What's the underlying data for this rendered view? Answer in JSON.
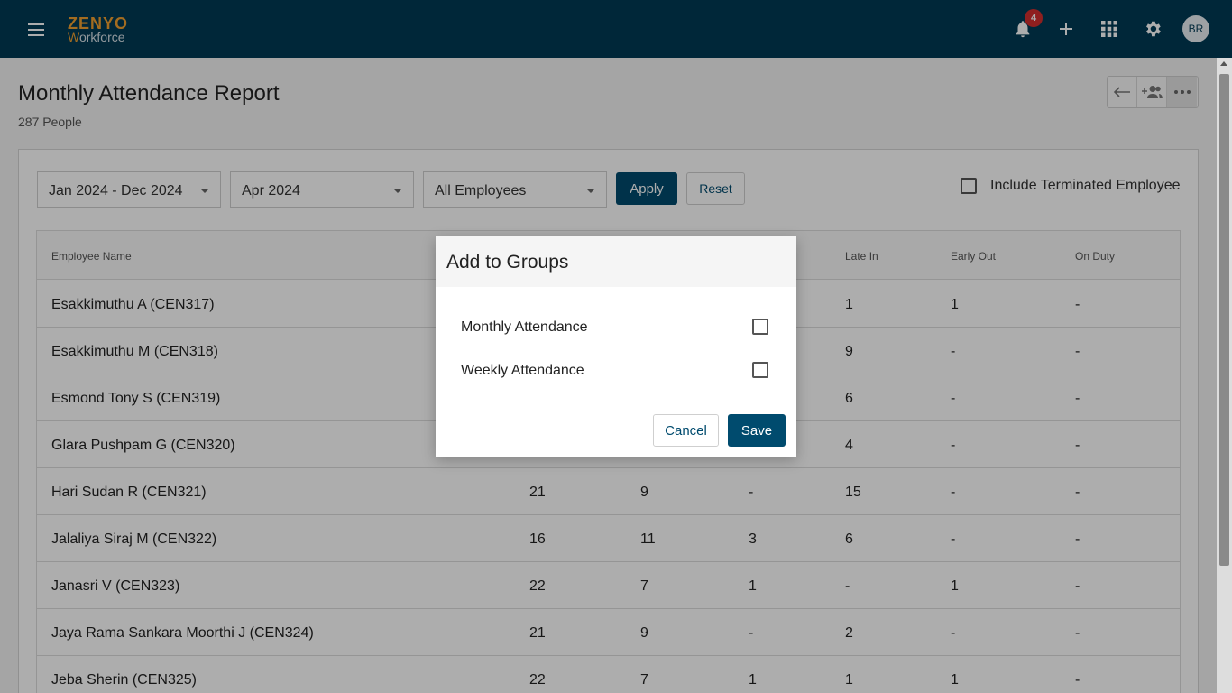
{
  "app": {
    "logo_top": "ZENYO",
    "logo_w": "W",
    "logo_rest": "orkforce",
    "notification_count": "4",
    "avatar_initials": "BR"
  },
  "page": {
    "title": "Monthly Attendance Report",
    "subtitle": "287 People"
  },
  "filters": {
    "period": "Jan 2024 - Dec 2024",
    "month": "Apr 2024",
    "employees": "All Employees",
    "apply_label": "Apply",
    "reset_label": "Reset",
    "include_terminated_label": "Include Terminated Employee"
  },
  "table": {
    "headers": {
      "name": "Employee Name",
      "late_in": "Late In",
      "early_out": "Early Out",
      "on_duty": "On Duty"
    },
    "rows": [
      {
        "name": "Esakkimuthu A (CEN317)",
        "c1": "",
        "c2": "",
        "c3": "",
        "late_in": "1",
        "early_out": "1",
        "on_duty": "-"
      },
      {
        "name": "Esakkimuthu M (CEN318)",
        "c1": "",
        "c2": "",
        "c3": "",
        "late_in": "9",
        "early_out": "-",
        "on_duty": "-"
      },
      {
        "name": "Esmond Tony S (CEN319)",
        "c1": "",
        "c2": "",
        "c3": "",
        "late_in": "6",
        "early_out": "-",
        "on_duty": "-"
      },
      {
        "name": "Glara Pushpam G (CEN320)",
        "c1": "",
        "c2": "",
        "c3": "",
        "late_in": "4",
        "early_out": "-",
        "on_duty": "-"
      },
      {
        "name": "Hari Sudan R (CEN321)",
        "c1": "21",
        "c2": "9",
        "c3": "-",
        "late_in": "15",
        "early_out": "-",
        "on_duty": "-"
      },
      {
        "name": "Jalaliya Siraj M (CEN322)",
        "c1": "16",
        "c2": "11",
        "c3": "3",
        "late_in": "6",
        "early_out": "-",
        "on_duty": "-"
      },
      {
        "name": "Janasri V (CEN323)",
        "c1": "22",
        "c2": "7",
        "c3": "1",
        "late_in": "-",
        "early_out": "1",
        "on_duty": "-"
      },
      {
        "name": "Jaya Rama Sankara Moorthi J (CEN324)",
        "c1": "21",
        "c2": "9",
        "c3": "-",
        "late_in": "2",
        "early_out": "-",
        "on_duty": "-"
      },
      {
        "name": "Jeba Sherin (CEN325)",
        "c1": "22",
        "c2": "7",
        "c3": "1",
        "late_in": "1",
        "early_out": "1",
        "on_duty": "-"
      }
    ]
  },
  "dialog": {
    "title": "Add to Groups",
    "options": [
      {
        "label": "Monthly Attendance",
        "checked": false
      },
      {
        "label": "Weekly Attendance",
        "checked": false
      }
    ],
    "cancel_label": "Cancel",
    "save_label": "Save"
  }
}
